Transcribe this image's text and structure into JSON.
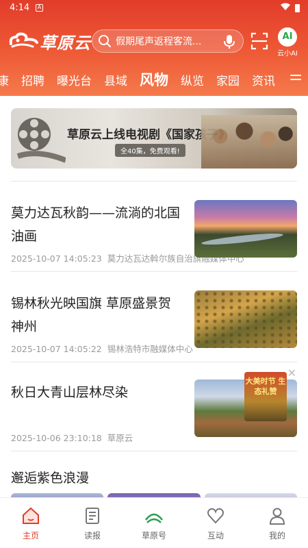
{
  "status_bar": {
    "time": "4:14",
    "notification_badge": "A"
  },
  "header": {
    "logo_text": "草原云",
    "search_placeholder": "假期尾声返程客流...",
    "ai_label": "云小AI",
    "ai_badge": "AI",
    "accent_color": "#e23c2a"
  },
  "tabs": [
    {
      "label": "康"
    },
    {
      "label": "招聘"
    },
    {
      "label": "曝光台"
    },
    {
      "label": "县域"
    },
    {
      "label": "风物",
      "active": true
    },
    {
      "label": "纵览"
    },
    {
      "label": "家园"
    },
    {
      "label": "资讯"
    }
  ],
  "banner": {
    "title": "草原云上线电视剧《国家孩子》",
    "subtitle": "全40集，免费观看!"
  },
  "news": [
    {
      "title": "莫力达瓦秋韵——流淌的北国油画",
      "date": "2025-10-07 14:05:23",
      "source": "莫力达瓦达斡尔族自治旗融媒体中心"
    },
    {
      "title": "锡林秋光映国旗 草原盛景贺神州",
      "date": "2025-10-07 14:05:22",
      "source": "锡林浩特市融媒体中心"
    },
    {
      "title": "秋日大青山层林尽染",
      "date": "2025-10-06 23:10:18",
      "source": "草原云"
    }
  ],
  "float_ad": {
    "text": "大美时节 生态礼赞",
    "close": "✕"
  },
  "section": {
    "title": "邂逅紫色浪漫"
  },
  "bottom_nav": [
    {
      "label": "主页",
      "icon": "home-icon",
      "active": true
    },
    {
      "label": "读报",
      "icon": "newspaper-icon"
    },
    {
      "label": "草原号",
      "icon": "grassland-icon"
    },
    {
      "label": "互动",
      "icon": "interaction-icon"
    },
    {
      "label": "我的",
      "icon": "profile-icon"
    }
  ]
}
